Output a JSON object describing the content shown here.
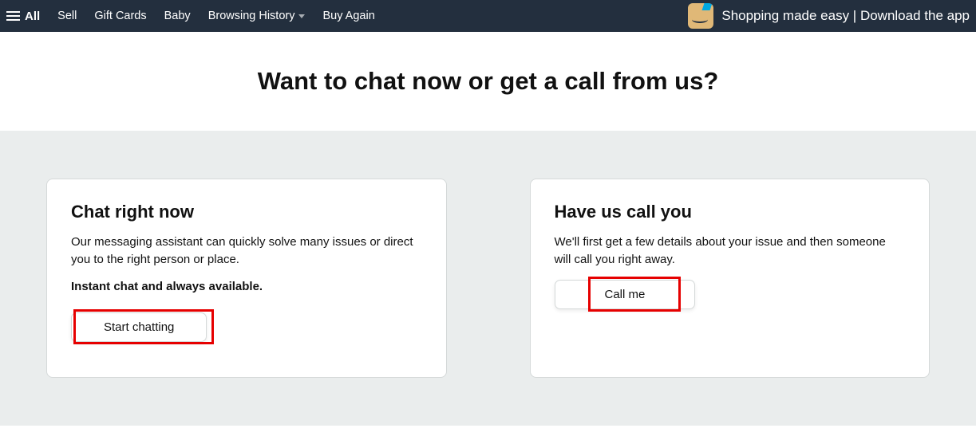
{
  "nav": {
    "all_label": "All",
    "links": [
      "Sell",
      "Gift Cards",
      "Baby",
      "Browsing History",
      "Buy Again"
    ],
    "promo_text": "Shopping made easy | Download the app"
  },
  "hero": {
    "title": "Want to chat now or get a call from us?"
  },
  "cards": {
    "chat": {
      "title": "Chat right now",
      "desc": "Our messaging assistant can quickly solve many issues or direct you to the right person or place.",
      "note": "Instant chat and always available.",
      "button_label": "Start chatting"
    },
    "call": {
      "title": "Have us call you",
      "desc": "We'll first get a few details about your issue and then someone will call you right away.",
      "button_label": "Call me"
    }
  }
}
